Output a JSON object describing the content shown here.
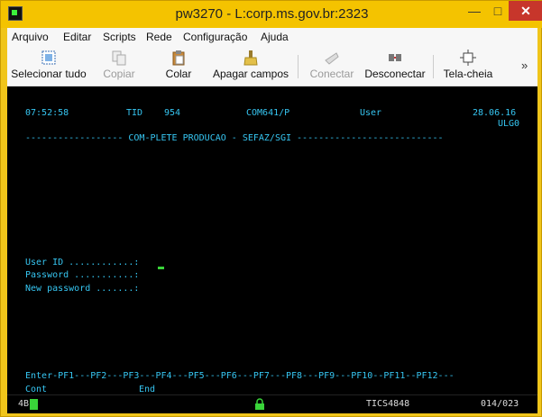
{
  "window": {
    "title": "pw3270 - L:corp.ms.gov.br:2323",
    "min": "—",
    "max": "□",
    "close": "✕"
  },
  "menu": [
    "Arquivo",
    "Editar",
    "Scripts",
    "Rede",
    "Configuração",
    "Ajuda"
  ],
  "toolbar": {
    "select_all": "Selecionar tudo",
    "copy": "Copiar",
    "paste": "Colar",
    "clear_fields": "Apagar campos",
    "connect": "Conectar",
    "disconnect": "Desconectar",
    "fullscreen": "Tela-cheia",
    "more": "»"
  },
  "screen": {
    "time": "07:52:58",
    "tid_label": "TID",
    "tid_value": "954",
    "program": "COM641/P",
    "user_label": "User",
    "date": "28.06.16",
    "code": "ULG0",
    "header_line": "------------------ COM-PLETE PRODUCAO - SEFAZ/SGI ---------------------------",
    "user_id_label": "User ID ............:",
    "password_label": "Password ...........:",
    "new_password_label": "New password .......:",
    "pf_line": "Enter-PF1---PF2---PF3---PF4---PF5---PF6---PF7---PF8---PF9---PF10--PF11--PF12---",
    "pf_cont": "Cont",
    "pf_end": "End"
  },
  "status": {
    "left_char": "4B",
    "session": "TICS4848",
    "position": "014/023"
  }
}
